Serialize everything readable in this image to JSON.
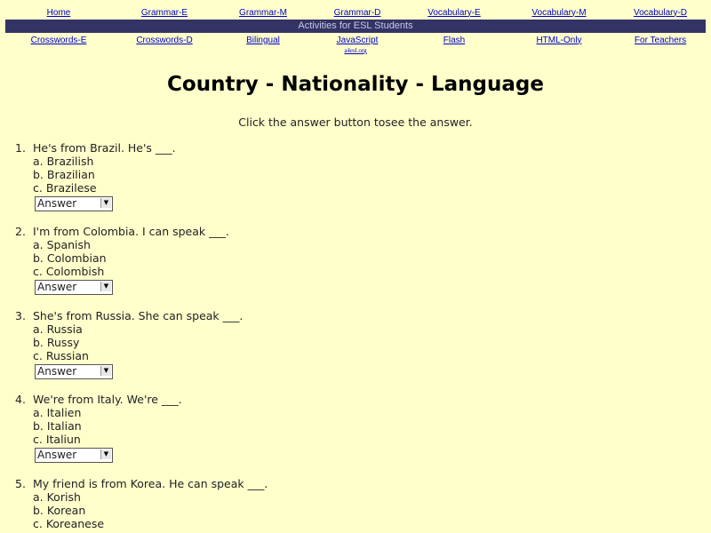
{
  "nav_top": [
    "Home",
    "Grammar-E",
    "Grammar-M",
    "Grammar-D",
    "Vocabulary-E",
    "Vocabulary-M",
    "Vocabulary-D"
  ],
  "banner": "Activities for ESL Students",
  "nav_bottom": [
    "Crosswords-E",
    "Crosswords-D",
    "Bilingual",
    "JavaScript",
    "Flash",
    "HTML-Only",
    "For Teachers"
  ],
  "sub_link": "a4esl.org",
  "title": "Country - Nationality - Language",
  "instruction": "Click the answer button tosee the answer.",
  "answer_label": "Answer",
  "questions": [
    {
      "num": "1.",
      "stem": "He's from Brazil. He's ___.",
      "options": [
        "a. Brazilish",
        "b. Brazilian",
        "c. Brazilese"
      ]
    },
    {
      "num": "2.",
      "stem": "I'm from Colombia. I can speak ___.",
      "options": [
        "a. Spanish",
        "b. Colombian",
        "c. Colombish"
      ]
    },
    {
      "num": "3.",
      "stem": "She's from Russia. She can speak ___.",
      "options": [
        "a. Russia",
        "b. Russy",
        "c. Russian"
      ]
    },
    {
      "num": "4.",
      "stem": "We're from Italy. We're ___.",
      "options": [
        "a. Italien",
        "b. Italian",
        "c. Italiun"
      ]
    },
    {
      "num": "5.",
      "stem": "My friend is from Korea. He can speak ___.",
      "options": [
        "a. Korish",
        "b. Korean",
        "c. Koreanese"
      ]
    }
  ]
}
